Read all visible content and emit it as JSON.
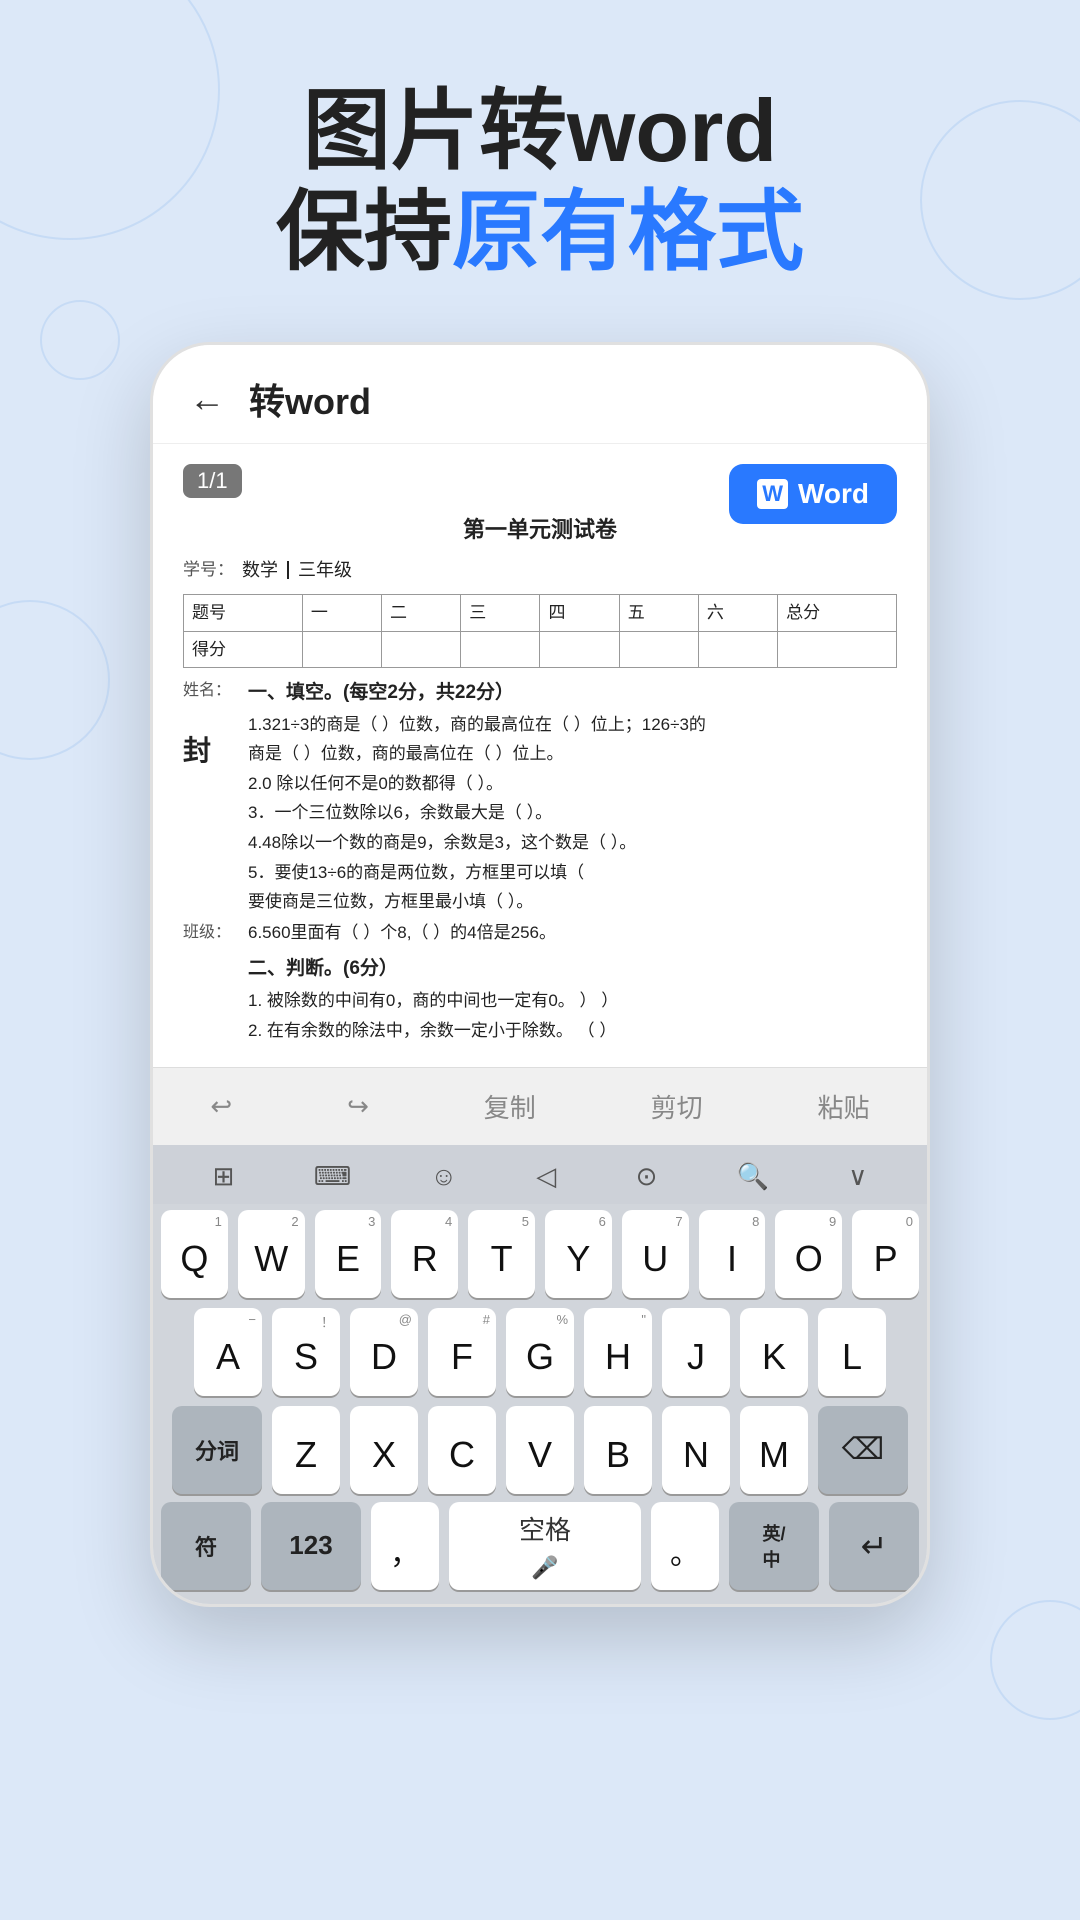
{
  "hero": {
    "line1": "图片转word",
    "line2_pre": "保持",
    "line2_highlight": "原有格式"
  },
  "phone": {
    "topbar": {
      "back": "←",
      "title": "转word"
    },
    "page_badge": "1/1",
    "word_button": "Word",
    "doc": {
      "title": "第一单元测试卷",
      "subtitle_label": "学号：",
      "subtitle_value": "数学",
      "subtitle_grade": "三年级",
      "table_headers": [
        "题号",
        "一",
        "二",
        "三",
        "四",
        "五",
        "六",
        "总分"
      ],
      "table_row": [
        "得分",
        "",
        "",
        "",
        "",
        "",
        "",
        ""
      ],
      "section1": "一、填空。(每空2分，共22分）",
      "paras": [
        "1.321÷3的商是（ ）位数，商的最高位在（ ）位上；126÷3的",
        "商是（ ）位数，商的最高位在（ ）位上。",
        "2.0 除以任何不是0的数都得（ ）。",
        "3．一个三位数除以6，余数最大是（ ）。",
        "4.48除以一个数的商是9，余数是3，这个数是（ ）。",
        "5．要使13÷6的商是两位数，方框里可以填（",
        "要使商是三位数，方框里最小填（ ）。",
        "6.560里面有（   ）个8,（  ）的4倍是256。"
      ],
      "section2": "二、判断。(6分）",
      "judge_paras": [
        "1. 被除数的中间有0，商的中间也一定有0。   ）          ）",
        "2. 在有余数的除法中，余数一定小于除数。   （  ）"
      ],
      "side_labels": {
        "name_label": "姓名：",
        "seal": "封",
        "class_label": "班级："
      }
    },
    "toolbar": {
      "undo": "↩",
      "redo": "↪",
      "copy": "复制",
      "cut": "剪切",
      "paste": "粘贴"
    },
    "keyboard": {
      "func_row": [
        "⊞",
        "⌨",
        "☺",
        "</>",
        "⊙",
        "🔍",
        "∨"
      ],
      "rows": [
        [
          {
            "sub": "1",
            "main": "Q"
          },
          {
            "sub": "2",
            "main": "W"
          },
          {
            "sub": "3",
            "main": "E"
          },
          {
            "sub": "4",
            "main": "R"
          },
          {
            "sub": "5",
            "main": "T"
          },
          {
            "sub": "6",
            "main": "Y"
          },
          {
            "sub": "7",
            "main": "U"
          },
          {
            "sub": "8",
            "main": "I"
          },
          {
            "sub": "9",
            "main": "O"
          },
          {
            "sub": "0",
            "main": "P"
          }
        ],
        [
          {
            "sub": "−",
            "main": "A"
          },
          {
            "sub": "！",
            "main": "S"
          },
          {
            "sub": "@",
            "main": "D"
          },
          {
            "sub": "#",
            "main": "F"
          },
          {
            "sub": "%",
            "main": "G"
          },
          {
            "sub": "\"",
            "main": "H"
          },
          {
            "sub": "",
            "main": "J"
          },
          {
            "sub": "",
            "main": "K"
          },
          {
            "sub": "",
            "main": "L"
          }
        ],
        [
          {
            "sub": "",
            "main": "Z",
            "special": false
          },
          {
            "sub": "",
            "main": "X"
          },
          {
            "sub": "",
            "main": "C"
          },
          {
            "sub": "",
            "main": "V"
          },
          {
            "sub": "",
            "main": "B"
          },
          {
            "sub": "",
            "main": "N"
          },
          {
            "sub": "",
            "main": "M"
          }
        ]
      ],
      "shift_label": "分词",
      "backspace": "⌫",
      "symbols": "符",
      "num": "123",
      "comma": "，",
      "space": "空格",
      "period": "。",
      "lang": "英/中",
      "enter": "↵"
    }
  }
}
